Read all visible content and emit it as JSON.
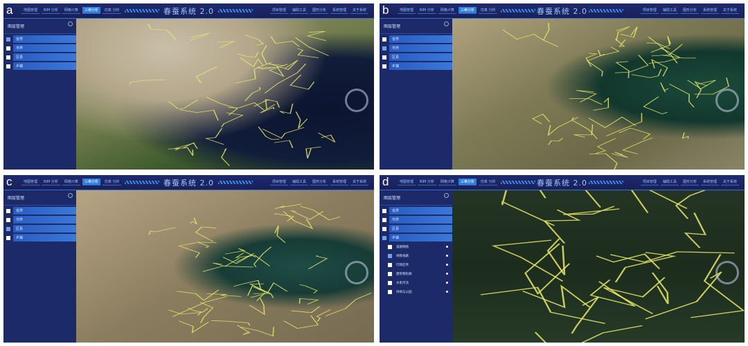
{
  "app_title": "春蚕系统 2.0",
  "nav_left": [
    "地图管理",
    "BIM 分析",
    "网格计算",
    "三维分析",
    "仿真 分析"
  ],
  "nav_right": [
    "项目管理",
    "辅助工具",
    "图形分析",
    "系统管理",
    "关于系统"
  ],
  "sidebar_title": "图层管理",
  "layers": [
    "省界",
    "市界",
    "区县",
    "乡镇"
  ],
  "sublayers": [
    "道路网络",
    "地铁线路",
    "行政区界",
    "建筑物轮廓",
    "水系河流",
    "绿地与公园"
  ],
  "panels": [
    {
      "label": "a",
      "checked": [
        0
      ],
      "map": "country"
    },
    {
      "label": "b",
      "checked": [
        1
      ],
      "map": "province"
    },
    {
      "label": "c",
      "checked": [
        2
      ],
      "map": "county"
    },
    {
      "label": "d",
      "checked": [
        3
      ],
      "sub_checked": [
        1
      ],
      "map": "city"
    }
  ],
  "colors": {
    "header": "#1f2b6e",
    "sidebar": "#1c2a6a",
    "accent": "#2f7fd8",
    "boundary": "#e8e86a"
  }
}
